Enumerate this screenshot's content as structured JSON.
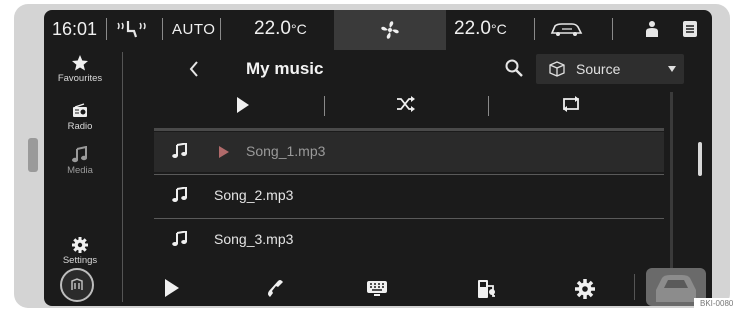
{
  "status_bar": {
    "time": "16:01",
    "climate_mode": "AUTO",
    "temp_left": "22.0",
    "temp_right": "22.0",
    "temp_unit": "°C",
    "icons": [
      "seat-heating-icon",
      "fan-icon",
      "car-icon",
      "person-icon",
      "document-icon"
    ]
  },
  "sidebar": {
    "items": [
      {
        "label": "Favourites",
        "icon": "star-icon"
      },
      {
        "label": "Radio",
        "icon": "radio-icon"
      },
      {
        "label": "Media",
        "icon": "music-note-icon"
      },
      {
        "label": "Settings",
        "icon": "gear-icon"
      }
    ]
  },
  "header": {
    "title": "My music",
    "source_label": "Source"
  },
  "controls": [
    "play-icon",
    "shuffle-icon",
    "repeat-icon"
  ],
  "songs": [
    {
      "name": "Song_1.mp3",
      "playing": true
    },
    {
      "name": "Song_2.mp3",
      "playing": false
    },
    {
      "name": "Song_3.mp3",
      "playing": false
    }
  ],
  "dock": [
    "music-app-icon",
    "play-icon",
    "phone-icon",
    "keyboard-icon",
    "fuel-icon",
    "gear-icon",
    "car-icon"
  ],
  "image_code": "BKI-0080",
  "colors": {
    "screen_bg": "#1b1b1b",
    "bezel": "#d4d4d4",
    "text": "#e6e6e6",
    "dimmed_text": "#9a9a9a",
    "highlight_bg": "#3a3a3a"
  }
}
